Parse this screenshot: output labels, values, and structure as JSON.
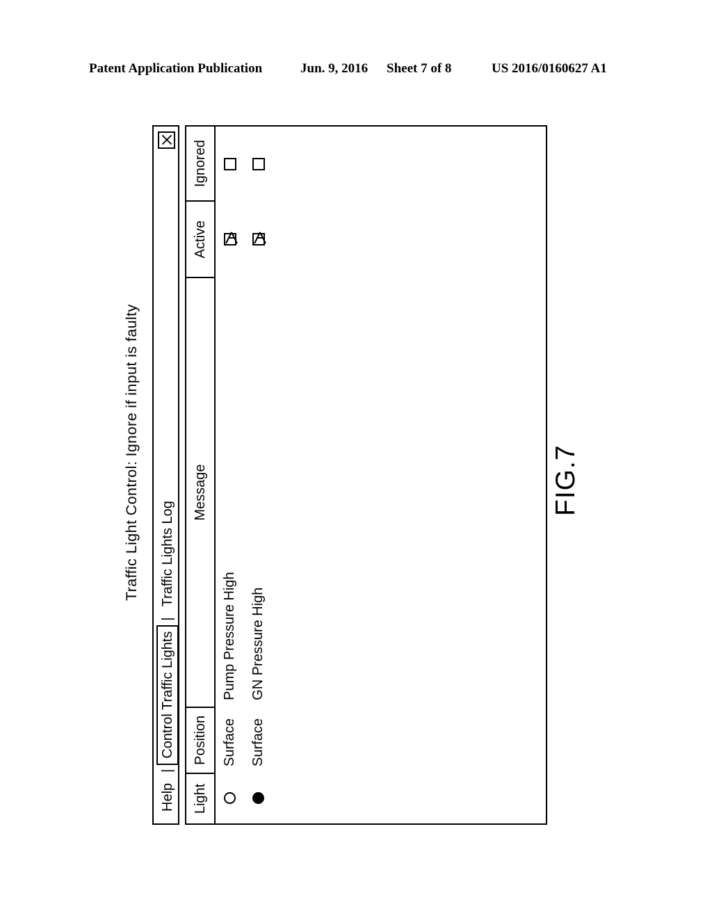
{
  "patent_header": {
    "publication": "Patent Application Publication",
    "date": "Jun. 9, 2016",
    "sheet": "Sheet 7 of 8",
    "publication_number": "US 2016/0160627 A1"
  },
  "figure": {
    "label": "FIG.7"
  },
  "window": {
    "title": "Traffic Light Control: Ignore if input is faulty",
    "close_icon": "close-x-icon",
    "menubar": {
      "items": [
        {
          "label": "Help",
          "selected": false
        },
        {
          "label": "|",
          "separator": true
        },
        {
          "label": "Control Traffic Lights",
          "selected": true
        },
        {
          "label": "|",
          "separator": true
        },
        {
          "label": "Traffic Lights Log",
          "selected": false
        }
      ]
    },
    "table": {
      "columns": [
        "Light",
        "Position",
        "Message",
        "Active",
        "Ignored"
      ],
      "rows": [
        {
          "light": "off",
          "position": "Surface",
          "message": "Pump Pressure High",
          "active": true,
          "ignored": false
        },
        {
          "light": "on",
          "position": "Surface",
          "message": "GN Pressure High",
          "active": true,
          "ignored": false
        }
      ]
    }
  },
  "colors": {
    "ink": "#000000",
    "paper": "#ffffff"
  }
}
